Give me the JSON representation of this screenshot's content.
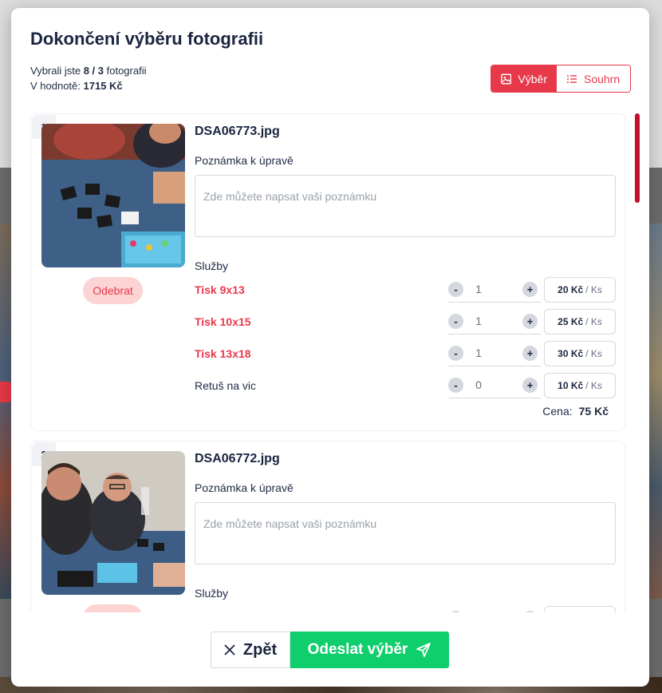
{
  "modal": {
    "title": "Dokončení výběru fotografii",
    "summary": {
      "selected_prefix": "Vybrali jste ",
      "selected_count": "8 / 3",
      "selected_suffix": " fotografii",
      "value_prefix": "V hodnotě: ",
      "value": "1715 Kč"
    },
    "view_toggle": {
      "selection_label": "Výběr",
      "summary_label": "Souhrn",
      "active": "selection"
    }
  },
  "photos": [
    {
      "index": "1",
      "filename": "DSA06773.jpg",
      "remove_label": "Odebrat",
      "note_label": "Poznámka k úpravě",
      "note_placeholder": "Zde můžete napsat vaši poznámku",
      "services_label": "Služby",
      "services": [
        {
          "name": "Tisk 9x13",
          "qty": "1",
          "price": "20 Kč",
          "unit": "/ Ks",
          "highlighted": true
        },
        {
          "name": "Tisk 10x15",
          "qty": "1",
          "price": "25 Kč",
          "unit": "/ Ks",
          "highlighted": true
        },
        {
          "name": "Tisk 13x18",
          "qty": "1",
          "price": "30 Kč",
          "unit": "/ Ks",
          "highlighted": true
        },
        {
          "name": "Retuš na vic",
          "qty": "0",
          "price": "10 Kč",
          "unit": "/ Ks",
          "highlighted": false
        }
      ],
      "price_label": "Cena:",
      "price_value": "75 Kč"
    },
    {
      "index": "2",
      "filename": "DSA06772.jpg",
      "note_label": "Poznámka k úpravě",
      "note_placeholder": "Zde můžete napsat vaši poznámku",
      "services_label": "Služby"
    }
  ],
  "footer": {
    "back_label": "Zpět",
    "submit_label": "Odeslat výběr"
  },
  "colors": {
    "accent": "#e8394b",
    "submit": "#0fcf6c",
    "remove_bg": "#fcd4d4"
  },
  "icons": {
    "selection": "image-icon",
    "summary": "list-icon",
    "back": "close-icon",
    "submit": "send-icon"
  }
}
